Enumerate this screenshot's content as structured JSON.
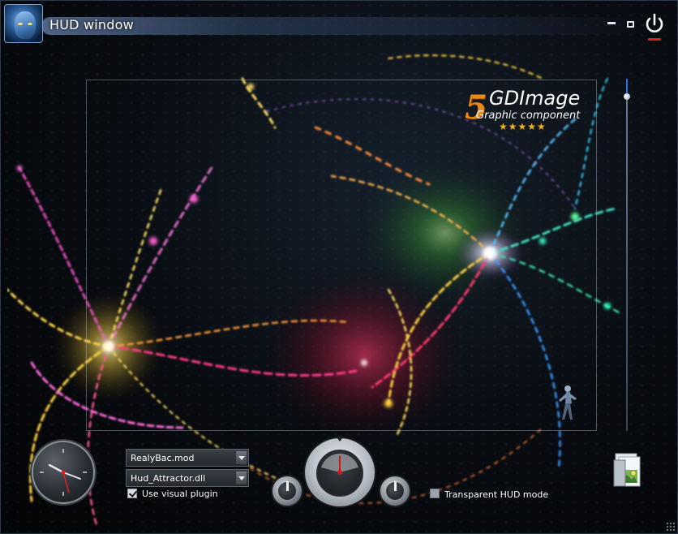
{
  "window": {
    "title": "HUD window",
    "controls": [
      "minimize",
      "maximize",
      "power"
    ]
  },
  "logo": {
    "number": "5",
    "name": "GDImage",
    "tagline": "Graphic component",
    "stars": "★★★★★"
  },
  "controls": {
    "plugin_select": {
      "value": "RealyBac.mod"
    },
    "attractor_select": {
      "value": "Hud_Attractor.dll"
    },
    "use_visual_plugin": {
      "label": "Use visual plugin",
      "checked": true
    },
    "transparent_hud_mode": {
      "label": "Transparent HUD mode",
      "checked": false
    },
    "vertical_slider": {
      "value": 0.05
    }
  },
  "icons": {
    "power": "power-icon",
    "gallery": "image-gallery-icon",
    "clock": "analog-clock-icon",
    "avatar": "avatar-icon"
  },
  "colors": {
    "power_indicator": "#e02020",
    "slider_fill": "#2c6fe0",
    "logo_orange": "#e88a1a",
    "stars": "#f5b21a"
  }
}
